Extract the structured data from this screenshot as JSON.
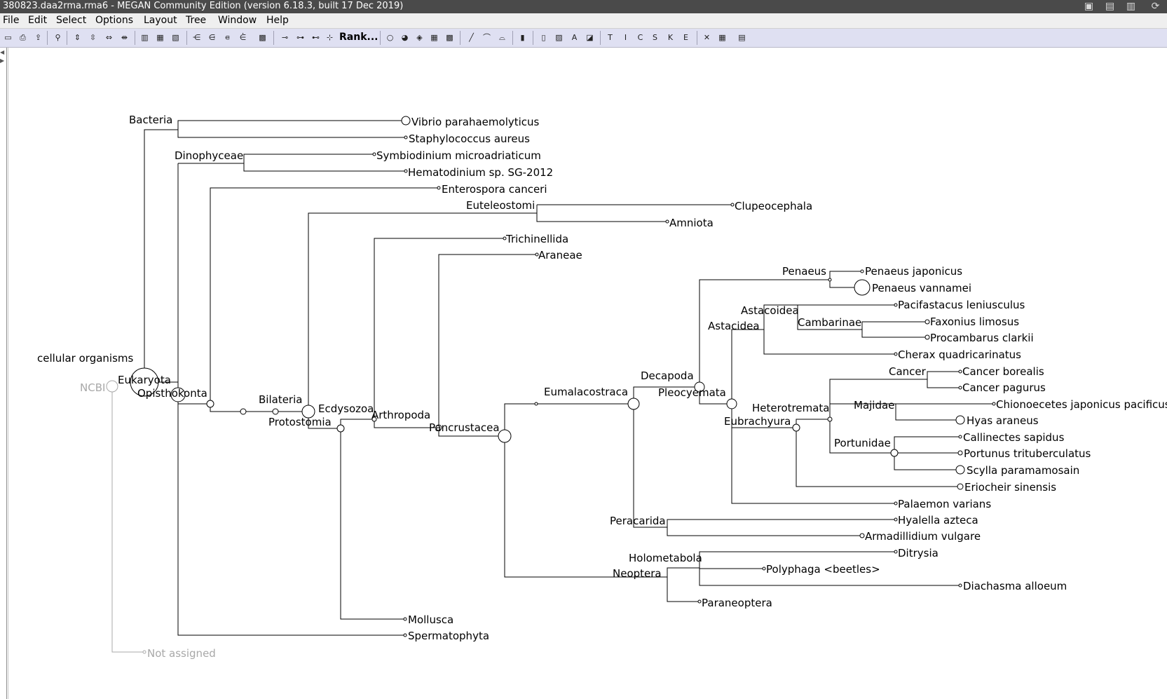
{
  "window": {
    "title": "380823.daa2rma.rma6 - MEGAN Community Edition (version 6.18.3, built 17 Dec 2019)"
  },
  "menu": [
    "File",
    "Edit",
    "Select",
    "Options",
    "Layout",
    "Tree",
    "Window",
    "Help"
  ],
  "toolbar": {
    "rank_label": "Rank..."
  },
  "tree": {
    "root_label": "NCBI",
    "nodes": {
      "cellular_organisms": "cellular organisms",
      "eukaryota": "Eukaryota",
      "opisthokonta": "Opisthokonta",
      "bacteria": "Bacteria",
      "vibrio": "Vibrio parahaemolyticus",
      "staph": "Staphylococcus aureus",
      "dinophyceae": "Dinophyceae",
      "symbiodinium": "Symbiodinium microadriaticum",
      "hematodinium": "Hematodinium sp. SG-2012",
      "enterospora": "Enterospora canceri",
      "euteleostomi": "Euteleostomi",
      "clupeocephala": "Clupeocephala",
      "amniota": "Amniota",
      "bilateria": "Bilateria",
      "protostomia": "Protostomia",
      "ecdysozoa": "Ecdysozoa",
      "arthropoda": "Arthropoda",
      "trichinellida": "Trichinellida",
      "araneae": "Araneae",
      "pancrustacea": "Pancrustacea",
      "eumalacostraca": "Eumalacostraca",
      "decapoda": "Decapoda",
      "pleocyemata": "Pleocyemata",
      "penaeus": "Penaeus",
      "penaeus_japonicus": "Penaeus japonicus",
      "penaeus_vannamei": "Penaeus vannamei",
      "astacoidea": "Astacoidea",
      "astacidea": "Astacidea",
      "cambarinae": "Cambarinae",
      "pacifastacus": "Pacifastacus leniusculus",
      "faxonius": "Faxonius limosus",
      "procambarus": "Procambarus clarkii",
      "cherax": "Cherax quadricarinatus",
      "cancer": "Cancer",
      "cancer_borealis": "Cancer borealis",
      "cancer_pagurus": "Cancer pagurus",
      "heterotremata": "Heterotremata",
      "eubrachyura": "Eubrachyura",
      "majidae": "Majidae",
      "chionoecetes": "Chionoecetes japonicus pacificus",
      "hyas": "Hyas araneus",
      "portunidae": "Portunidae",
      "callinectes": "Callinectes sapidus",
      "portunus": "Portunus trituberculatus",
      "scylla": "Scylla paramamosain",
      "eriocheir": "Eriocheir sinensis",
      "palaemon": "Palaemon varians",
      "peracarida": "Peracarida",
      "hyalella": "Hyalella azteca",
      "armadillidium": "Armadillidium vulgare",
      "holometabola": "Holometabola",
      "neoptera": "Neoptera",
      "ditrysia": "Ditrysia",
      "polyphaga": "Polyphaga <beetles>",
      "diachasma": "Diachasma alloeum",
      "paraneoptera": "Paraneoptera",
      "mollusca": "Mollusca",
      "spermatophyta": "Spermatophyta",
      "not_assigned": "Not assigned"
    }
  },
  "colors": {
    "titlebar": "#4a4a4a",
    "toolbar": "#dfe0f2",
    "tree_line": "#000000",
    "unassigned": "#a8a8a8"
  }
}
